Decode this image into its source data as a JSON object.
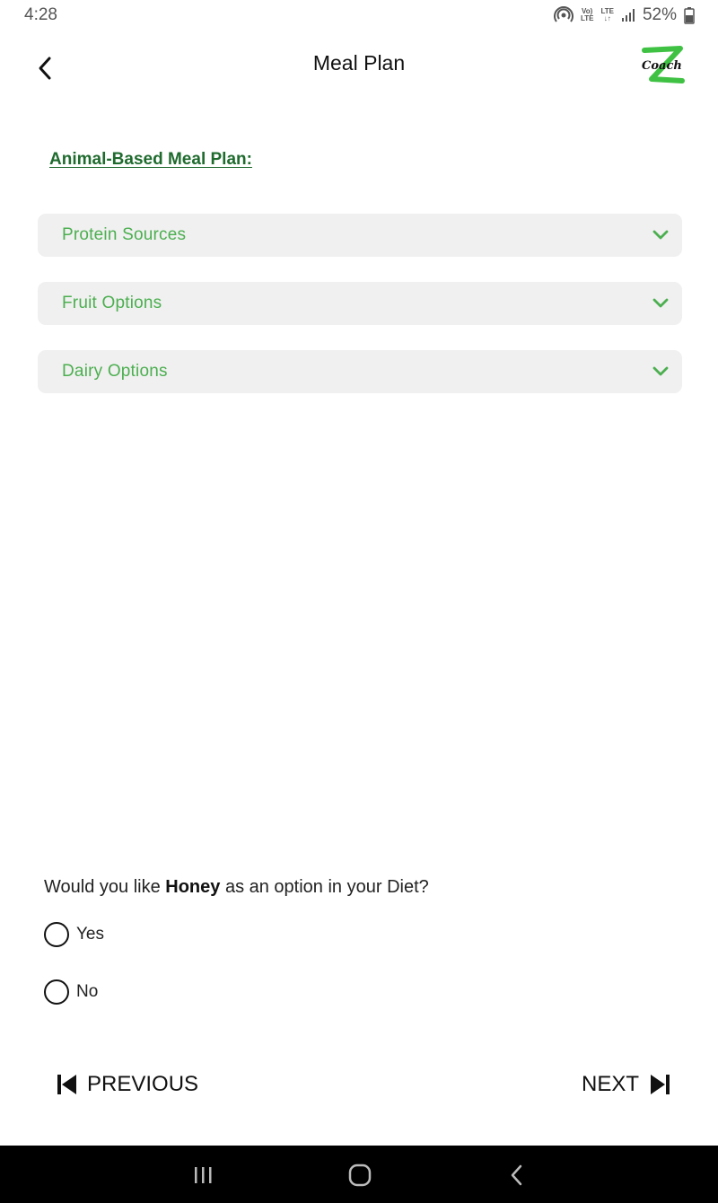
{
  "status_bar": {
    "time": "4:28",
    "volte_top": "Vo)",
    "volte_bottom": "LTE",
    "lte_top": "LTE",
    "battery_text": "52%"
  },
  "header": {
    "title": "Meal Plan",
    "back_icon": "chevron-left-icon",
    "logo_text": "Coach"
  },
  "section": {
    "heading": "Animal-Based Meal Plan:"
  },
  "accordions": [
    {
      "label": "Protein Sources",
      "icon": "chevron-down-icon"
    },
    {
      "label": "Fruit Options",
      "icon": "chevron-down-icon"
    },
    {
      "label": "Dairy Options",
      "icon": "chevron-down-icon"
    }
  ],
  "question": {
    "prefix": "Would you like ",
    "highlight": "Honey",
    "suffix": " as an option in your Diet?",
    "options": [
      {
        "label": "Yes",
        "selected": false
      },
      {
        "label": "No",
        "selected": false
      }
    ]
  },
  "navigation": {
    "previous_label": "PREVIOUS",
    "next_label": "NEXT"
  },
  "colors": {
    "accent_green": "#4caf50",
    "heading_green": "#1f6b2e",
    "accordion_bg": "#f0f0f0"
  }
}
